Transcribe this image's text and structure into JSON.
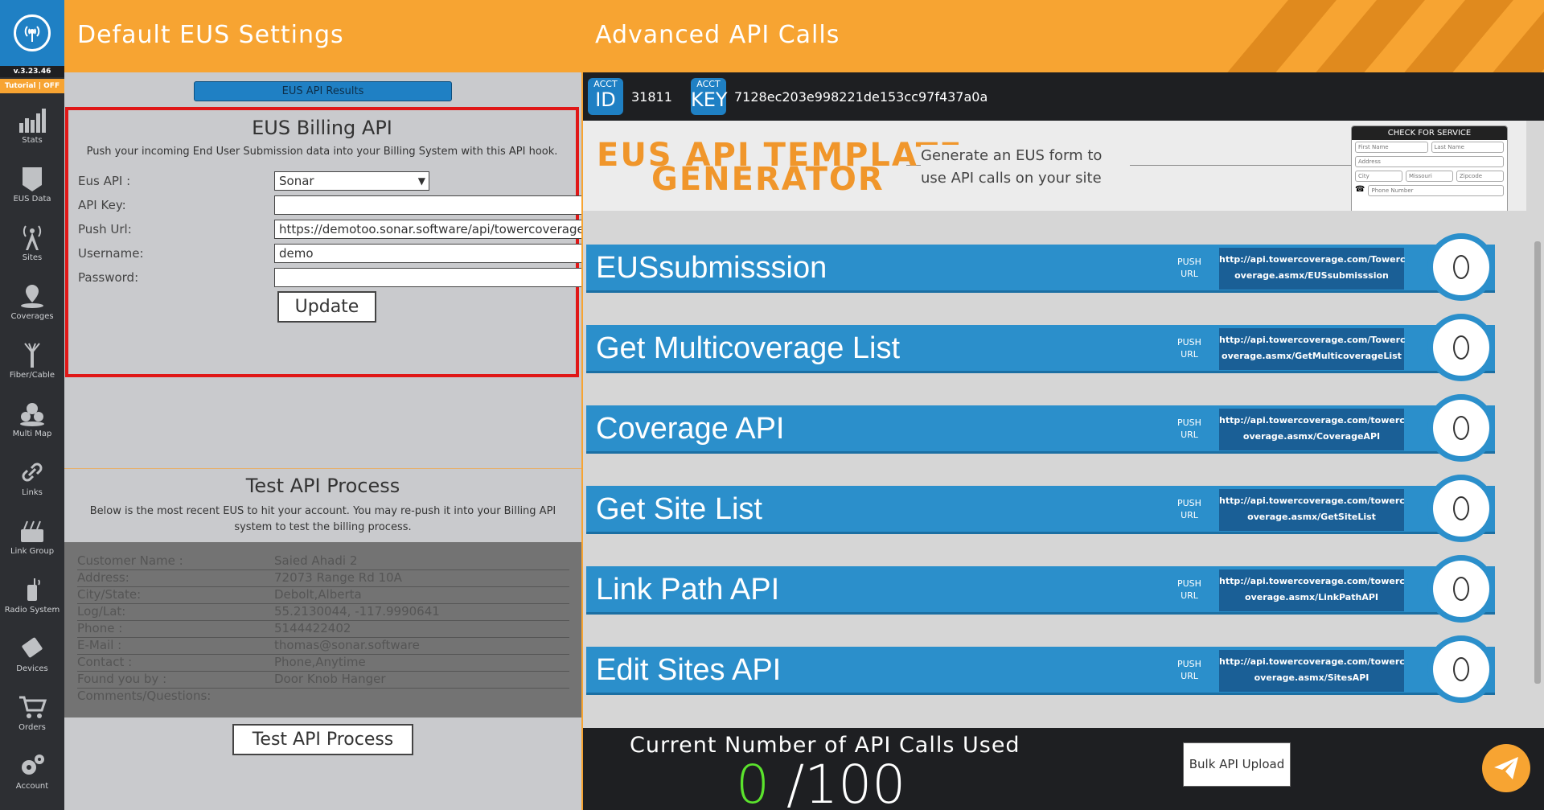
{
  "sidebar": {
    "version": "v.3.23.46",
    "tutorial": "Tutorial | OFF",
    "items": [
      {
        "label": "Stats",
        "icon": "stats-icon"
      },
      {
        "label": "EUS Data",
        "icon": "eus-data-icon"
      },
      {
        "label": "Sites",
        "icon": "tower-icon"
      },
      {
        "label": "Coverages",
        "icon": "coverage-pin-icon"
      },
      {
        "label": "Fiber/Cable",
        "icon": "fiber-icon"
      },
      {
        "label": "Multi Map",
        "icon": "multi-map-icon"
      },
      {
        "label": "Links",
        "icon": "link-icon"
      },
      {
        "label": "Link Group",
        "icon": "link-group-icon"
      },
      {
        "label": "Radio System",
        "icon": "radio-icon"
      },
      {
        "label": "Devices",
        "icon": "device-icon"
      },
      {
        "label": "Orders",
        "icon": "cart-icon"
      },
      {
        "label": "Account",
        "icon": "gear-icon"
      }
    ]
  },
  "header": {
    "left_title": "Default EUS Settings",
    "right_title": "Advanced API Calls"
  },
  "left": {
    "results_button": "EUS API Results",
    "billing": {
      "title": "EUS Billing API",
      "description": "Push your incoming End User Submission data into your Billing System with this API hook.",
      "fields": {
        "eus_api_label": "Eus API :",
        "eus_api_value": "Sonar",
        "api_key_label": "API Key:",
        "api_key_value": "",
        "push_url_label": "Push Url:",
        "push_url_value": "https://demotoo.sonar.software/api/towercoverage",
        "username_label": "Username:",
        "username_value": "demo",
        "password_label": "Password:",
        "password_value": ""
      },
      "update_button": "Update"
    },
    "test": {
      "title": "Test API Process",
      "description": "Below is the most recent EUS to hit your account. You may re-push it into your Billing API system to test the billing process.",
      "rows": [
        {
          "label": "Customer Name :",
          "value": "Saied Ahadi   2"
        },
        {
          "label": "Address:",
          "value": "72073 Range Rd 10A"
        },
        {
          "label": "City/State:",
          "value": "Debolt,Alberta"
        },
        {
          "label": "Log/Lat:",
          "value": "55.2130044, -117.9990641"
        },
        {
          "label": "Phone :",
          "value": "5144422402"
        },
        {
          "label": "E-Mail :",
          "value": "thomas@sonar.software"
        },
        {
          "label": "Contact :",
          "value": "Phone,Anytime"
        },
        {
          "label": "Found you by :",
          "value": "Door Knob Hanger"
        },
        {
          "label": "Comments/Questions:",
          "value": ""
        }
      ],
      "button": "Test API Process"
    }
  },
  "right": {
    "acct_id_small": "ACCT",
    "acct_id_big": "ID",
    "acct_id_value": "31811",
    "acct_key_small": "ACCT",
    "acct_key_big": "KEY",
    "acct_key_value": "7128ec203e998221de153cc97f437a0a",
    "template": {
      "title_line1": "EUS API TEMPLATE",
      "title_line2": "GENERATOR",
      "description": "Generate an EUS form to use API calls on your site",
      "preview_header": "CHECK FOR SERVICE",
      "preview_first": "First Name",
      "preview_last": "Last Name",
      "preview_address": "Address",
      "preview_city": "City",
      "preview_state": "Missouri",
      "preview_zip": "Zipcode",
      "preview_phone": "Phone Number"
    },
    "push_label_line1": "PUSH",
    "push_label_line2": "URL",
    "apis": [
      {
        "name": "EUSsubmisssion",
        "url_line1": "http://api.towercoverage.com/Towerc",
        "url_line2": "overage.asmx/EUSsubmisssion"
      },
      {
        "name": "Get Multicoverage List",
        "url_line1": "http://api.towercoverage.com/Towerc",
        "url_line2": "overage.asmx/GetMulticoverageList"
      },
      {
        "name": "Coverage API",
        "url_line1": "http://api.towercoverage.com/towerc",
        "url_line2": "overage.asmx/CoverageAPI"
      },
      {
        "name": "Get Site List",
        "url_line1": "http://api.towercoverage.com/towerc",
        "url_line2": "overage.asmx/GetSiteList"
      },
      {
        "name": "Link Path API",
        "url_line1": "http://api.towercoverage.com/towerc",
        "url_line2": "overage.asmx/LinkPathAPI"
      },
      {
        "name": "Edit Sites API",
        "url_line1": "http://api.towercoverage.com/towerc",
        "url_line2": "overage.asmx/SitesAPI"
      }
    ],
    "usage": {
      "label": "Current Number of API Calls Used",
      "used": "0",
      "total": "/100"
    },
    "bulk_button": "Bulk API Upload"
  },
  "colors": {
    "accent_orange": "#f7a432",
    "accent_blue": "#2b8fcb",
    "highlight_red": "#e01717",
    "usage_green": "#5be32d"
  }
}
